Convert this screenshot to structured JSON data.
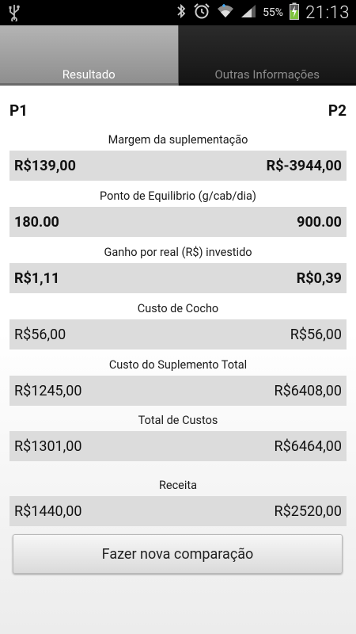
{
  "status_bar": {
    "battery_percent": "55%",
    "time": "21:13",
    "icons": [
      "usb-icon",
      "bluetooth-icon",
      "alarm-icon",
      "wifi-icon",
      "signal-icon",
      "battery-charging-icon"
    ]
  },
  "tabs": [
    {
      "label": "Resultado",
      "selected": true
    },
    {
      "label": "Outras Informações",
      "selected": false
    }
  ],
  "header": {
    "p1": "P1",
    "p2": "P2"
  },
  "metrics": [
    {
      "label": "Margem da suplementação",
      "p1": "R$139,00",
      "p2": "R$-3944,00"
    },
    {
      "label": "Ponto de Equilibrio (g/cab/dia)",
      "p1": "180.00",
      "p2": "900.00"
    },
    {
      "label": "Ganho por real (R$) investido",
      "p1": "R$1,11",
      "p2": "R$0,39"
    },
    {
      "label": "Custo de Cocho",
      "p1": "R$56,00",
      "p2": "R$56,00"
    },
    {
      "label": "Custo do Suplemento Total",
      "p1": "R$1245,00",
      "p2": "R$6408,00"
    },
    {
      "label": "Total de Custos",
      "p1": "R$1301,00",
      "p2": "R$6464,00"
    },
    {
      "label": "Receita",
      "p1": "R$1440,00",
      "p2": "R$2520,00"
    }
  ],
  "button": {
    "label": "Fazer nova comparação"
  },
  "colors": {
    "tab_active": "#9e9e9e",
    "tab_inactive": "#1e1e1e",
    "row_bg": "#dcdcdc",
    "statusbar_bg": "#000000"
  }
}
